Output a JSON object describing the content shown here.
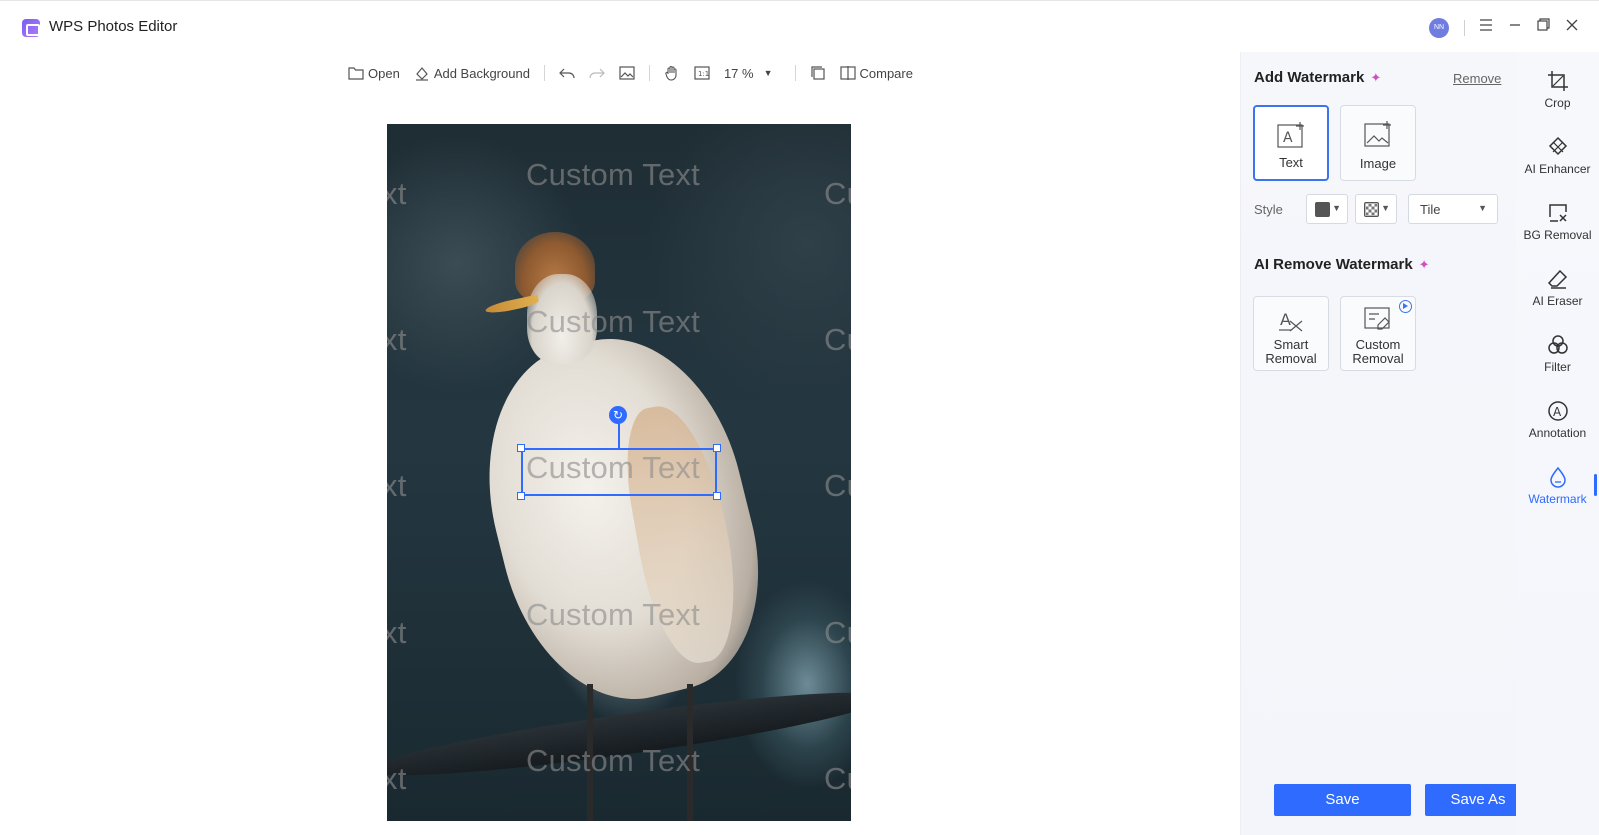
{
  "app": {
    "title": "WPS Photos Editor",
    "avatar_initials": "NN"
  },
  "toolbar": {
    "open_label": "Open",
    "add_background_label": "Add Background",
    "zoom_value": "17 %",
    "compare_label": "Compare"
  },
  "canvas": {
    "watermark_text": "Custom Text",
    "watermark_fragment_left": "xt",
    "watermark_fragment_right": "Cu"
  },
  "panel": {
    "add_watermark_title": "Add Watermark",
    "remove_link": "Remove",
    "type_text_label": "Text",
    "type_image_label": "Image",
    "style_label": "Style",
    "layout_value": "Tile",
    "ai_remove_title": "AI Remove Watermark",
    "smart_removal_line1": "Smart",
    "smart_removal_line2": "Removal",
    "custom_removal_line1": "Custom",
    "custom_removal_line2": "Removal",
    "save_label": "Save",
    "save_as_label": "Save As"
  },
  "rail": {
    "items": [
      {
        "label": "Crop",
        "icon": "crop-icon"
      },
      {
        "label": "AI Enhancer",
        "icon": "ai-enhancer-icon"
      },
      {
        "label": "BG Removal",
        "icon": "bg-removal-icon"
      },
      {
        "label": "AI Eraser",
        "icon": "eraser-icon"
      },
      {
        "label": "Filter",
        "icon": "filter-icon"
      },
      {
        "label": "Annotation",
        "icon": "annotation-icon"
      },
      {
        "label": "Watermark",
        "icon": "watermark-icon",
        "active": true
      }
    ]
  },
  "colors": {
    "accent": "#2f6bff",
    "spark": "#d050c0",
    "watermark_color": "#555555"
  }
}
